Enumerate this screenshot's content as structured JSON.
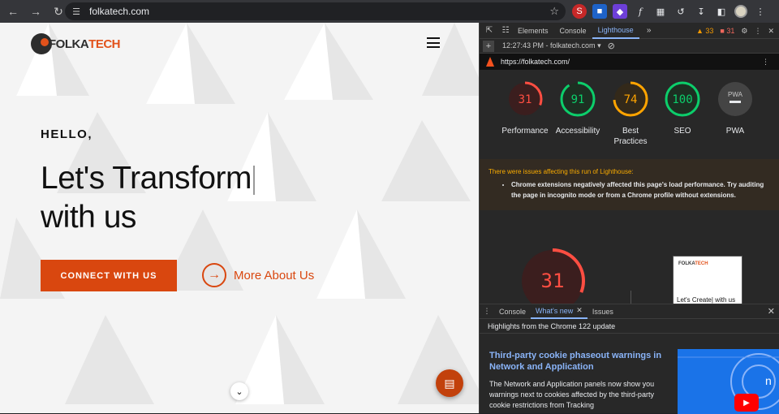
{
  "browser": {
    "url": "folkatech.com",
    "extensions": [
      "red-extension-icon",
      "blue-extension-icon",
      "purple-extension-icon",
      "function-icon",
      "puzzle-icon"
    ]
  },
  "site": {
    "logo_prefix": "F",
    "logo_main": "FOLKA",
    "logo_accent": "TECH",
    "hello": "HELLO,",
    "hero_line1": "Let's Transform",
    "hero_line2": "with us",
    "cta_label": "CONNECT WITH US",
    "more_label": "More About Us",
    "colors": {
      "accent": "#d9470f",
      "text": "#111111"
    }
  },
  "devtools": {
    "tabs": [
      "Elements",
      "Console",
      "Lighthouse"
    ],
    "active_tab": "Lighthouse",
    "warnings_count": "33",
    "errors_count": "31",
    "report_time": "12:27:43 PM - folkatech.com",
    "report_url": "https://folkatech.com/",
    "scores": [
      {
        "label": "Performance",
        "value": "31",
        "fraction": 0.31,
        "color": "#ff4e42",
        "bg": "#3b1e1e"
      },
      {
        "label": "Accessibility",
        "value": "91",
        "fraction": 0.91,
        "color": "#0cce6b",
        "bg": "#1d2f22"
      },
      {
        "label": "Best Practices",
        "value": "74",
        "fraction": 0.74,
        "color": "#ffa400",
        "bg": "#33291a"
      },
      {
        "label": "SEO",
        "value": "100",
        "fraction": 1.0,
        "color": "#0cce6b",
        "bg": "#1d2f22"
      },
      {
        "label": "PWA",
        "value": "PWA",
        "fraction": 0,
        "color": "#9aa0a6",
        "bg": "#444444"
      }
    ],
    "issues_heading": "There were issues affecting this run of Lighthouse:",
    "issues_item": "Chrome extensions negatively affected this page's load performance. Try auditing the page in incognito mode or from a Chrome profile without extensions.",
    "big_score": {
      "value": "31",
      "fraction": 0.31
    },
    "thumb_text": "Let's Create| with us",
    "thumb_logo_main": "FOLKA",
    "thumb_logo_accent": "TECH"
  },
  "drawer": {
    "tabs": [
      "Console",
      "What's new",
      "Issues"
    ],
    "active_tab": "What's new",
    "highlights": "Highlights from the Chrome 122 update",
    "article_title": "Third-party cookie phaseout warnings in Network and Application",
    "article_body": "The Network and Application panels now show you warnings next to cookies affected by the third-party cookie restrictions from Tracking"
  }
}
